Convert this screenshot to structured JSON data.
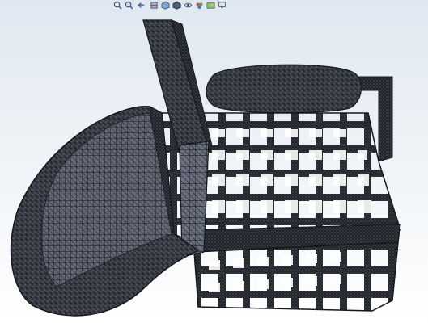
{
  "app": {
    "view_mode": "wireframe",
    "background_gradient": [
      "#dfe8f1",
      "#ffffff"
    ],
    "model_color": "#2c2f36"
  },
  "heads_up_toolbar": {
    "items": [
      {
        "icon": "zoom-to-fit-icon"
      },
      {
        "icon": "zoom-to-area-icon"
      },
      {
        "icon": "previous-view-icon"
      },
      {
        "icon": "section-view-icon"
      },
      {
        "icon": "view-orientation-icon"
      },
      {
        "icon": "display-style-icon"
      },
      {
        "icon": "hide-show-items-icon"
      },
      {
        "icon": "edit-appearance-icon"
      },
      {
        "icon": "apply-scene-icon"
      },
      {
        "icon": "view-settings-icon"
      }
    ]
  }
}
